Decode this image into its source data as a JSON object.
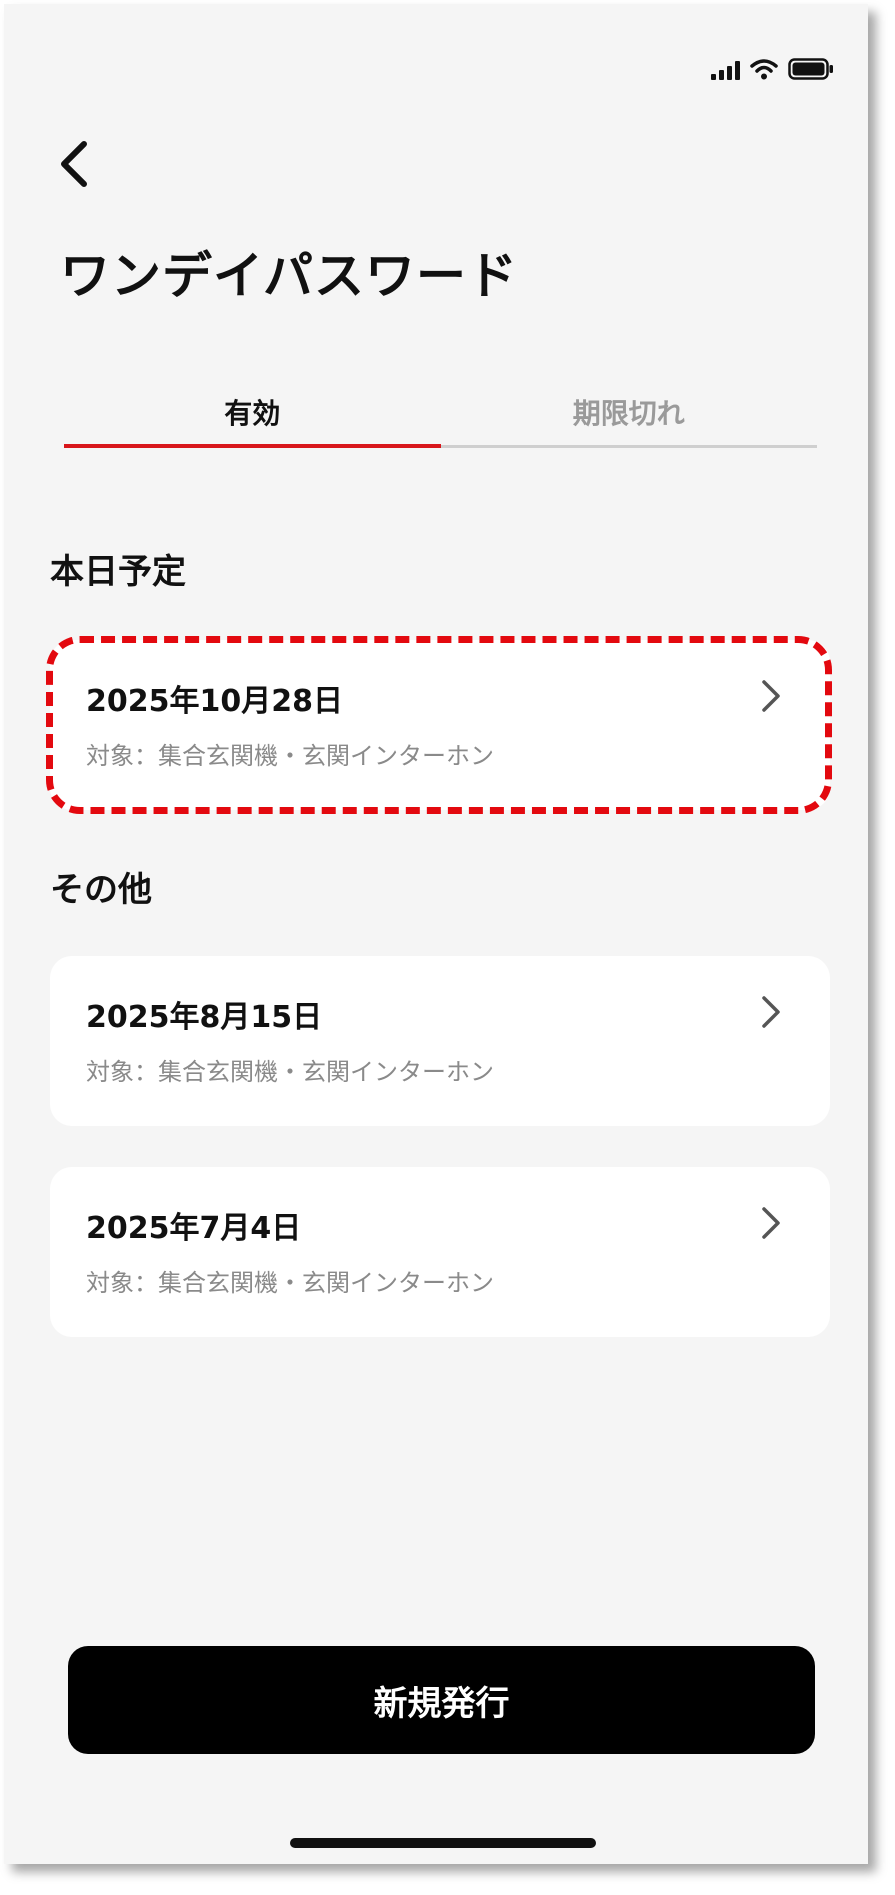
{
  "status_bar": {
    "icons": [
      "signal-icon",
      "wifi-icon",
      "battery-icon"
    ]
  },
  "header": {
    "back_icon": "chevron-left-icon",
    "title": "ワンデイパスワード"
  },
  "tabs": [
    {
      "label": "有効",
      "active": true
    },
    {
      "label": "期限切れ",
      "active": false
    }
  ],
  "sections": {
    "today": {
      "label": "本日予定",
      "items": [
        {
          "date": "2025年10月28日",
          "target": "対象：集合玄関機・玄関インターホン"
        }
      ]
    },
    "other": {
      "label": "その他",
      "items": [
        {
          "date": "2025年8月15日",
          "target": "対象：集合玄関機・玄関インターホン"
        },
        {
          "date": "2025年7月4日",
          "target": "対象：集合玄関機・玄関インターホン"
        }
      ]
    }
  },
  "actions": {
    "new_issue_label": "新規発行"
  },
  "colors": {
    "accent": "#d8161b",
    "highlight": "#e3090f",
    "background": "#f5f5f5",
    "button": "#000000"
  }
}
